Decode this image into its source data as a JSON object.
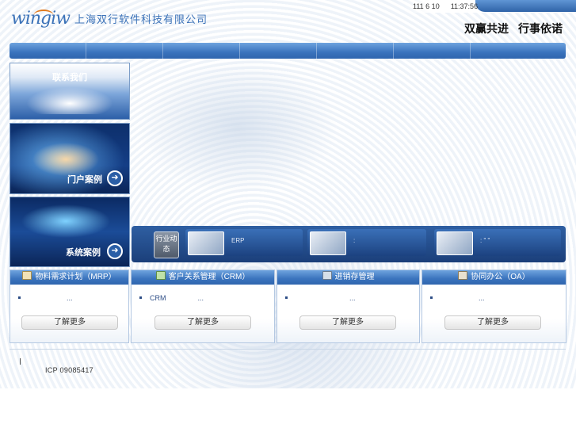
{
  "header": {
    "logo_text": "wingiw",
    "company_name": "上海双行软件科技有限公司",
    "date": "111 6 10",
    "time": "11:37:56",
    "slogan_left": "双赢共进",
    "slogan_right": "行事依诺"
  },
  "nav": {
    "item_count_visual": 7
  },
  "banners": {
    "contact": {
      "label": "联系我们"
    },
    "portal_cases": {
      "label": "门户案例",
      "icon": "arrow-right-circle-icon"
    },
    "system_cases": {
      "label": "系统案例",
      "icon": "arrow-right-circle-icon"
    }
  },
  "news": {
    "tag": "行业动态",
    "items": [
      {
        "text": "ERP"
      },
      {
        "text": ":"
      },
      {
        "text": ": \" \""
      }
    ]
  },
  "products": [
    {
      "title": "物料需求计划（MRP）",
      "icon": "book-icon",
      "line_prefix": "",
      "line_suffix": "...",
      "button": "了解更多"
    },
    {
      "title": "客户关系管理（CRM）",
      "icon": "people-icon",
      "line_prefix": "CRM",
      "line_suffix": "...",
      "button": "了解更多"
    },
    {
      "title": "进销存管理",
      "icon": "calculator-icon",
      "line_prefix": "",
      "line_suffix": "...",
      "button": "了解更多"
    },
    {
      "title": "协同办公（OA）",
      "icon": "office-icon",
      "line_prefix": "",
      "line_suffix": "...",
      "button": "了解更多"
    }
  ],
  "footer": {
    "icp": "ICP 09085417"
  },
  "colors": {
    "brand_blue": "#3b72b8",
    "nav_blue": "#3a73bd",
    "accent_orange": "#e07a1f"
  }
}
